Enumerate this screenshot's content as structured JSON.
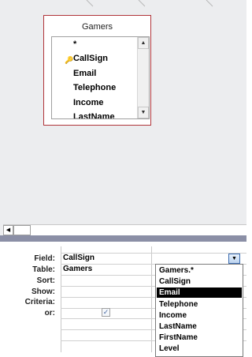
{
  "table_box": {
    "title": "Gamers",
    "fields": [
      {
        "name": "*",
        "key": false
      },
      {
        "name": "CallSign",
        "key": true
      },
      {
        "name": "Email",
        "key": false
      },
      {
        "name": "Telephone",
        "key": false
      },
      {
        "name": "Income",
        "key": false
      },
      {
        "name": "LastName",
        "key": false
      }
    ],
    "border_color": "#b0343a"
  },
  "grid": {
    "row_labels": [
      "Field:",
      "Table:",
      "Sort:",
      "Show:",
      "Criteria:",
      "or:"
    ],
    "field_value": "CallSign",
    "table_value": "Gamers",
    "show_checked": true
  },
  "dropdown": {
    "options": [
      "Gamers.*",
      "CallSign",
      "Email",
      "Telephone",
      "Income",
      "LastName",
      "FirstName",
      "Level"
    ],
    "selected": "Email",
    "selected_color": "#000000"
  },
  "colors": {
    "upper_background": "#ecedef",
    "splitter": "#8b8fa6"
  },
  "icons": {
    "key": "key-icon",
    "scroll_up": "scroll-up-arrow-icon",
    "scroll_down": "scroll-down-arrow-icon",
    "scroll_left": "scroll-left-arrow-icon",
    "dropdown_arrow": "chevron-down-icon"
  }
}
